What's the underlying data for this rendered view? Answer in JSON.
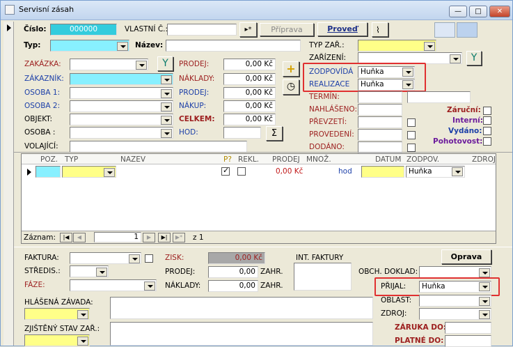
{
  "window": {
    "title": "Servisní zásah",
    "min": "—",
    "max": "□",
    "close": "✕"
  },
  "header": {
    "cislo_label": "Číslo:",
    "cislo_value": "000000",
    "vlastni_label": "VLASTNÍ Č.:",
    "vlastni_value": "",
    "new_btn": "▸*",
    "priprava": "Příprava",
    "provest": "Proveď",
    "typ_label": "Typ:",
    "nazev_label": "Název:"
  },
  "left": {
    "zakazka": "ZAKÁZKA:",
    "zakaznik": "ZÁKAZNÍK:",
    "osoba1": "OSOBA 1:",
    "osoba2": "OSOBA 2:",
    "objekt": "OBJEKT:",
    "osoba": "OSOBA :",
    "volajici": "VOLAJÍCÍ:"
  },
  "money": {
    "prodej_label": "PRODEJ:",
    "prodej": "0,00 Kč",
    "naklady_label": "NÁKLADY:",
    "naklady": "0,00 Kč",
    "prodej2_label": "PRODEJ:",
    "prodej2": "0,00 Kč",
    "nakup_label": "NÁKUP:",
    "nakup": "0,00 Kč",
    "celkem_label": "CELKEM:",
    "celkem": "0,00 Kč",
    "hod_label": "HOD:",
    "sum_btn": "Σ"
  },
  "right": {
    "typ_zar": "TYP ZAŘ.:",
    "zarizeni": "ZAŘÍZENÍ:",
    "zodpovida": "ZODPOVÍDÁ",
    "zodpovida_value": "Huňka",
    "realizace": "REALIZACE",
    "realizace_value": "Huňka",
    "termin": "TERMÍN:",
    "nahlaseno": "NAHLÁŠENO:",
    "prevzeti": "PŘEVZETÍ:",
    "provedeni": "PROVEDENÍ:",
    "dodano": "DODÁNO:",
    "zarucni": "Záruční:",
    "interni": "Interní:",
    "vydano": "Vydáno:",
    "pohotovost": "Pohotovost:"
  },
  "grid": {
    "columns": [
      "POZ.",
      "TYP",
      "NAZEV",
      "P?",
      "REKL.",
      "PRODEJ",
      "MNOŽ.",
      "",
      "DATUM",
      "ZODPOV.",
      "ZDROJ"
    ],
    "row": {
      "prodej": "0,00 Kč",
      "jednotka": "hod",
      "zodpov": "Huňka"
    },
    "nav_label": "Záznam:",
    "record": "1",
    "of": "z 1"
  },
  "bottom": {
    "faktura": "FAKTURA:",
    "stredis": "STŘEDIS.:",
    "faze": "FÁZE:",
    "zisk_label": "ZISK:",
    "zisk": "0,00 Kč",
    "prodej_label": "PRODEJ:",
    "prodej": "0,00",
    "zahr": "ZAHR.",
    "naklady_label": "NÁKLADY:",
    "naklady": "0,00",
    "zahr2": "ZAHR.",
    "int_faktury": "INT. FAKTURY",
    "oprava": "Oprava",
    "obch_doklad": "OBCH. DOKLAD:",
    "prijal": "PŘIJAL:",
    "prijal_value": "Huňka",
    "oblast": "OBLAST:",
    "zdroj": "ZDROJ:",
    "zaruka_do": "ZÁRUKA DO:",
    "platne_do": "PLATNÉ DO:",
    "hlasena": "HLÁŠENÁ ZÁVADA:",
    "zjisteny": "ZJIŠTĚNÝ STAV ZAŘ.:"
  }
}
